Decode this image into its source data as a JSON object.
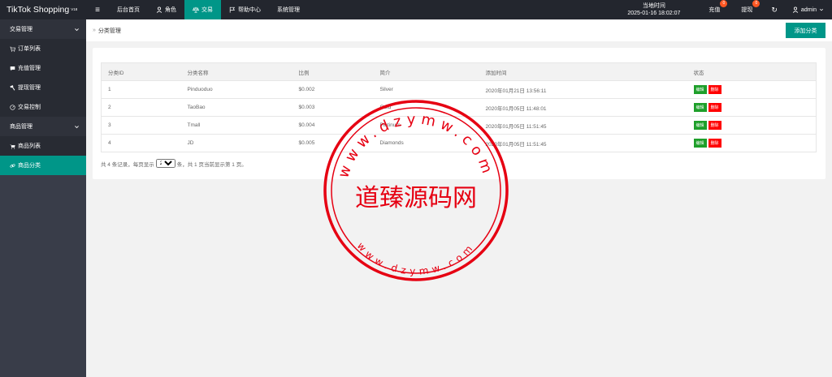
{
  "app": {
    "title": "TikTok Shopping",
    "version": "V18"
  },
  "topnav": {
    "menu_toggle": "≡",
    "items": [
      {
        "label": "后台首页",
        "icon": ""
      },
      {
        "label": "角色",
        "icon": "user-icon"
      },
      {
        "label": "交易",
        "icon": "scale-icon",
        "active": true
      },
      {
        "label": "帮助中心",
        "icon": "flag-icon"
      },
      {
        "label": "系统管理",
        "icon": ""
      }
    ]
  },
  "header_right": {
    "clock_label": "当地时间",
    "clock_value": "2025-01-16 18:02:07",
    "recharge": {
      "label": "充值",
      "badge": "0"
    },
    "withdraw": {
      "label": "提现",
      "badge": "0"
    },
    "refresh_icon": "↻",
    "admin": "admin"
  },
  "sidebar": {
    "groups": [
      {
        "label": "交易管理",
        "chevron": "⌄",
        "items": [
          {
            "label": "订单列表",
            "icon": "cart-icon"
          },
          {
            "label": "充值管理",
            "icon": "chat-icon"
          },
          {
            "label": "提现管理",
            "icon": "hammer-icon"
          },
          {
            "label": "交易控制",
            "icon": "gauge-icon"
          }
        ]
      },
      {
        "label": "商品管理",
        "chevron": "⌄",
        "items": [
          {
            "label": "商品列表",
            "icon": "cart-icon"
          },
          {
            "label": "商品分类",
            "icon": "link-icon",
            "active": true
          }
        ]
      }
    ]
  },
  "breadcrumb": {
    "sep": "»",
    "current": "分类管理"
  },
  "add_button": "添加分类",
  "table": {
    "headers": [
      "分类ID",
      "分类名称",
      "比例",
      "简介",
      "添加时间",
      "状态"
    ],
    "rows": [
      [
        "1",
        "Pinduoduo",
        "$0.002",
        "Silver",
        "2020年01月21日 13:56:11"
      ],
      [
        "2",
        "TaoBao",
        "$0.003",
        "Gold",
        "2020年01月05日 11:48:01"
      ],
      [
        "3",
        "Tmall",
        "$0.004",
        "Platinum",
        "2020年01月05日 11:51:45"
      ],
      [
        "4",
        "JD",
        "$0.005",
        "Diamonds",
        "2020年01月05日 11:51:45"
      ]
    ],
    "edit_label": "编辑",
    "delete_label": "删除"
  },
  "pager": {
    "prefix": "共 4 条记录，每页显示",
    "page_size": "20",
    "suffix": "条，共 1 页当前显示第 1 页。"
  },
  "watermark": {
    "center_text": "道臻源码网",
    "ring_text": "www.dzymw.com",
    "color": "#e60012"
  }
}
